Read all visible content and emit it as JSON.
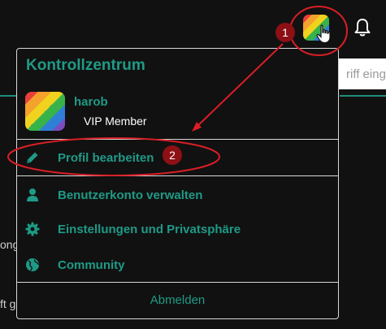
{
  "header": {
    "avatar_icon": "rainbow-avatar",
    "bell_icon": "bell-icon",
    "search_placeholder": "riff eing"
  },
  "background": {
    "text_a": "ong",
    "text_b": "ft g"
  },
  "annotations": {
    "marker_1": "1",
    "marker_2": "2",
    "color": "#d91e26"
  },
  "panel": {
    "title": "Kontrollzentrum",
    "user": {
      "name": "harob",
      "role": "VIP Member"
    },
    "items": [
      {
        "label": "Profil bearbeiten",
        "icon": "pencil-icon"
      },
      {
        "label": "Benutzerkonto verwalten",
        "icon": "user-icon"
      },
      {
        "label": "Einstellungen und Privatsphäre",
        "icon": "gear-icon"
      },
      {
        "label": "Community",
        "icon": "globe-icon"
      }
    ],
    "logout": "Abmelden",
    "accent": "#1f9a86"
  }
}
